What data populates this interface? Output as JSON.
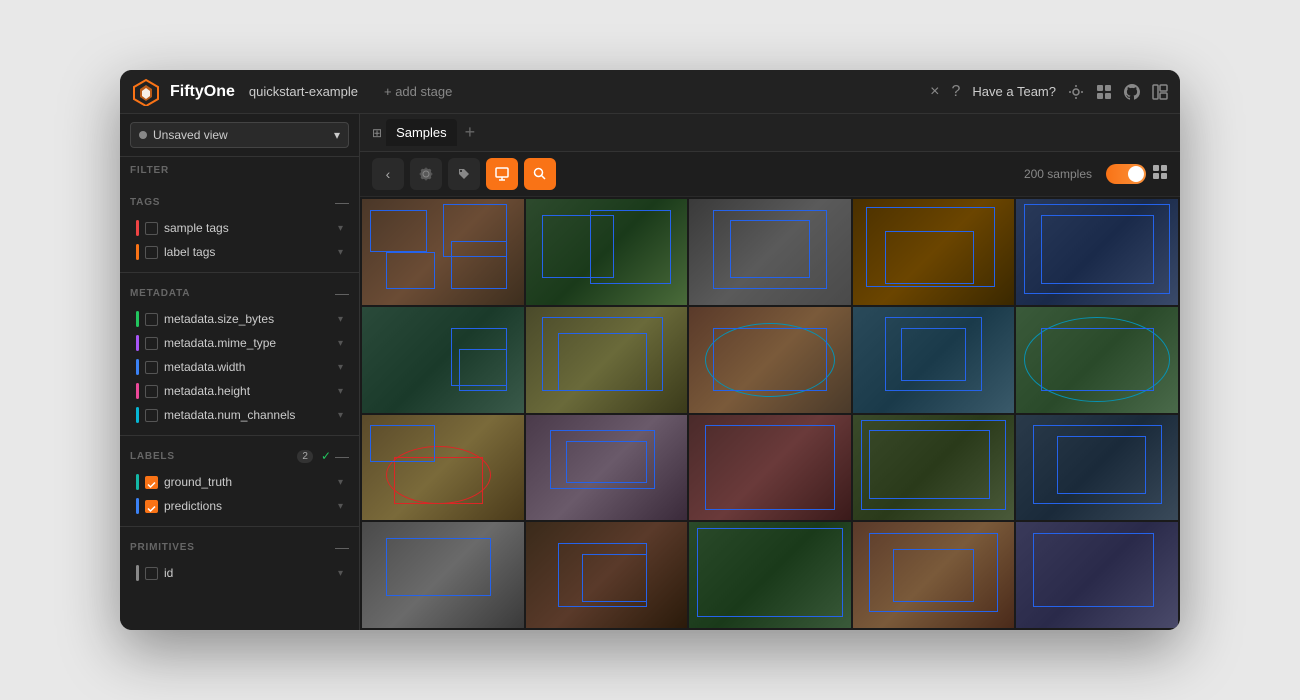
{
  "app": {
    "name": "FiftyOne",
    "dataset": "quickstart-example",
    "add_stage_label": "+ add stage",
    "have_team_label": "Have a Team?",
    "close_label": "×",
    "help_label": "?"
  },
  "sidebar": {
    "view_label": "Unsaved view",
    "filter_section": "FILTER",
    "tags_section": "TAGS",
    "sample_tags_label": "sample tags",
    "label_tags_label": "label tags",
    "metadata_section": "METADATA",
    "metadata_items": [
      "metadata.size_bytes",
      "metadata.mime_type",
      "metadata.width",
      "metadata.height",
      "metadata.num_channels"
    ],
    "labels_section": "LABELS",
    "labels_count": "2",
    "ground_truth_label": "ground_truth",
    "predictions_label": "predictions",
    "primitives_section": "PRIMITIVES",
    "id_label": "id"
  },
  "toolbar": {
    "back_label": "‹",
    "settings_label": "⚙",
    "tag_label": "🏷",
    "export_label": "⬆",
    "search_label": "🔍",
    "sample_count": "200 samples"
  },
  "tabs": [
    {
      "label": "Samples",
      "active": true
    },
    {
      "label": "+",
      "active": false
    }
  ],
  "images": [
    {
      "id": 1,
      "theme": "img-1"
    },
    {
      "id": 2,
      "theme": "img-2"
    },
    {
      "id": 3,
      "theme": "img-3"
    },
    {
      "id": 4,
      "theme": "img-4"
    },
    {
      "id": 5,
      "theme": "img-5"
    },
    {
      "id": 6,
      "theme": "img-6"
    },
    {
      "id": 7,
      "theme": "img-7"
    },
    {
      "id": 8,
      "theme": "img-8"
    },
    {
      "id": 9,
      "theme": "img-9"
    },
    {
      "id": 10,
      "theme": "img-10"
    },
    {
      "id": 11,
      "theme": "img-11"
    },
    {
      "id": 12,
      "theme": "img-12"
    },
    {
      "id": 13,
      "theme": "img-13"
    },
    {
      "id": 14,
      "theme": "img-14"
    },
    {
      "id": 15,
      "theme": "img-15"
    },
    {
      "id": 16,
      "theme": "img-16"
    },
    {
      "id": 17,
      "theme": "img-17"
    },
    {
      "id": 18,
      "theme": "img-18"
    },
    {
      "id": 19,
      "theme": "img-19"
    },
    {
      "id": 20,
      "theme": "img-20"
    }
  ]
}
